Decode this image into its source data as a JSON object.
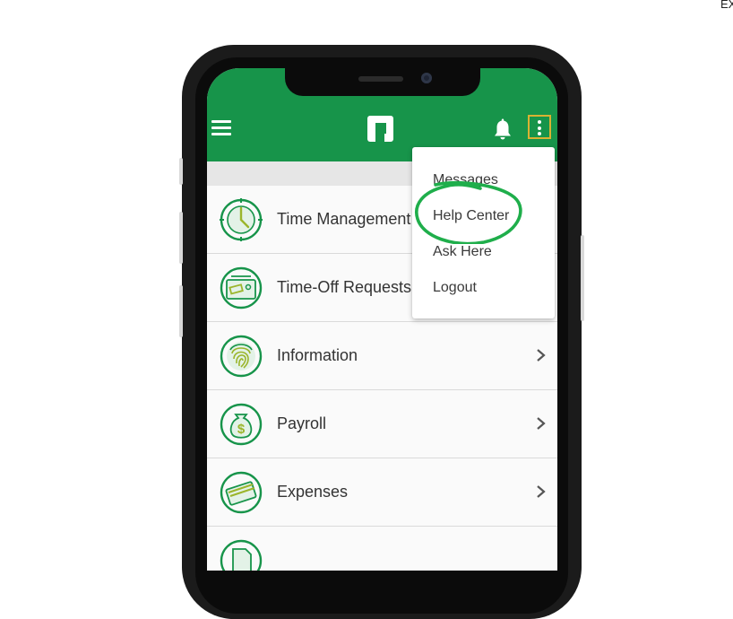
{
  "corner_text": "EX",
  "app_bar": {
    "menu_icon": "hamburger-icon",
    "logo_icon": "paylocity-logo-icon",
    "notifications_icon": "bell-icon",
    "more_icon": "more-vertical-icon"
  },
  "overflow_menu": {
    "items": [
      {
        "label": "Messages"
      },
      {
        "label": "Help Center",
        "highlighted": true
      },
      {
        "label": "Ask Here"
      },
      {
        "label": "Logout"
      }
    ]
  },
  "nav_list": {
    "items": [
      {
        "label": "Time Management",
        "icon": "clock-icon"
      },
      {
        "label": "Time-Off Requests",
        "icon": "ticket-icon"
      },
      {
        "label": "Information",
        "icon": "fingerprint-icon"
      },
      {
        "label": "Payroll",
        "icon": "money-bag-icon"
      },
      {
        "label": "Expenses",
        "icon": "credit-card-icon"
      },
      {
        "label": "",
        "icon": "document-icon"
      }
    ]
  },
  "colors": {
    "brand_green": "#17944a",
    "highlight_circle": "#1fae4b",
    "kebab_highlight": "#d9b232"
  }
}
